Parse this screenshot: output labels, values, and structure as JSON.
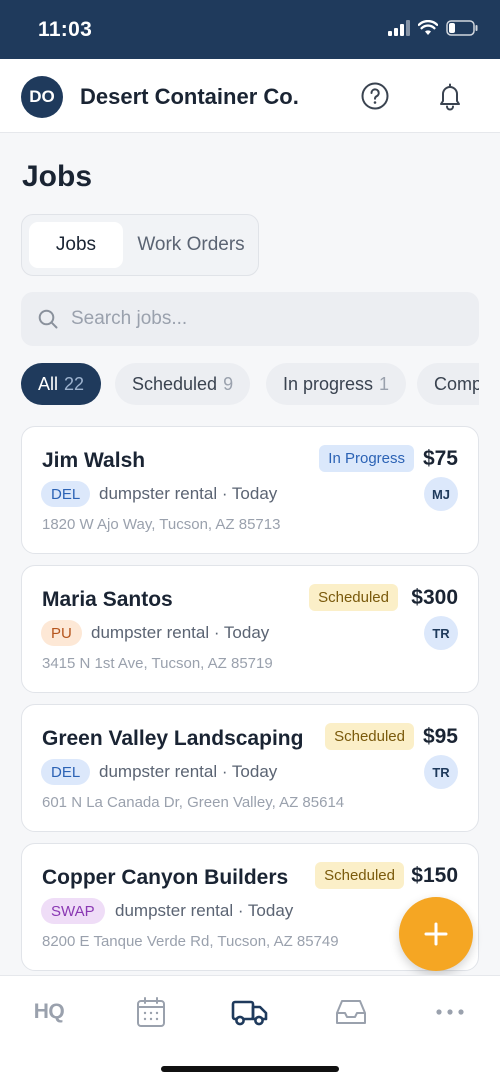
{
  "status_bar": {
    "time": "11:03"
  },
  "header": {
    "avatar_initials": "DO",
    "company_name": "Desert Container Co."
  },
  "page": {
    "title": "Jobs"
  },
  "segment": {
    "tabs": [
      "Jobs",
      "Work Orders"
    ],
    "active": "Jobs"
  },
  "search": {
    "placeholder": "Search jobs..."
  },
  "filters": [
    {
      "label": "All",
      "count": "22",
      "active": true
    },
    {
      "label": "Scheduled",
      "count": "9",
      "active": false
    },
    {
      "label": "In progress",
      "count": "1",
      "active": false
    },
    {
      "label": "Comp",
      "count": "",
      "active": false
    }
  ],
  "jobs": [
    {
      "name": "Jim Walsh",
      "status": "In Progress",
      "price": "$75",
      "type": "DEL",
      "meta": "dumpster rental · Today",
      "address": "1820 W Ajo Way, Tucson, AZ 85713",
      "assignee": "MJ"
    },
    {
      "name": "Maria Santos",
      "status": "Scheduled",
      "price": "$300",
      "type": "PU",
      "meta": "dumpster rental · Today",
      "address": "3415 N 1st Ave, Tucson, AZ 85719",
      "assignee": "TR"
    },
    {
      "name": "Green Valley Landscaping",
      "status": "Scheduled",
      "price": "$95",
      "type": "DEL",
      "meta": "dumpster rental · Today",
      "address": "601 N La Canada Dr, Green Valley, AZ 85614",
      "assignee": "TR"
    },
    {
      "name": "Copper Canyon Builders",
      "status": "Scheduled",
      "price": "$150",
      "type": "SWAP",
      "meta": "dumpster rental · Today",
      "address": "8200 E Tanque Verde Rd, Tucson, AZ 85749",
      "assignee": ""
    }
  ],
  "tabbar": {
    "hq_label": "HQ",
    "items": [
      "hq",
      "calendar",
      "truck",
      "inbox",
      "more"
    ],
    "active": "truck"
  },
  "colors": {
    "primary": "#1f3a5c",
    "accent": "#f5a623"
  }
}
